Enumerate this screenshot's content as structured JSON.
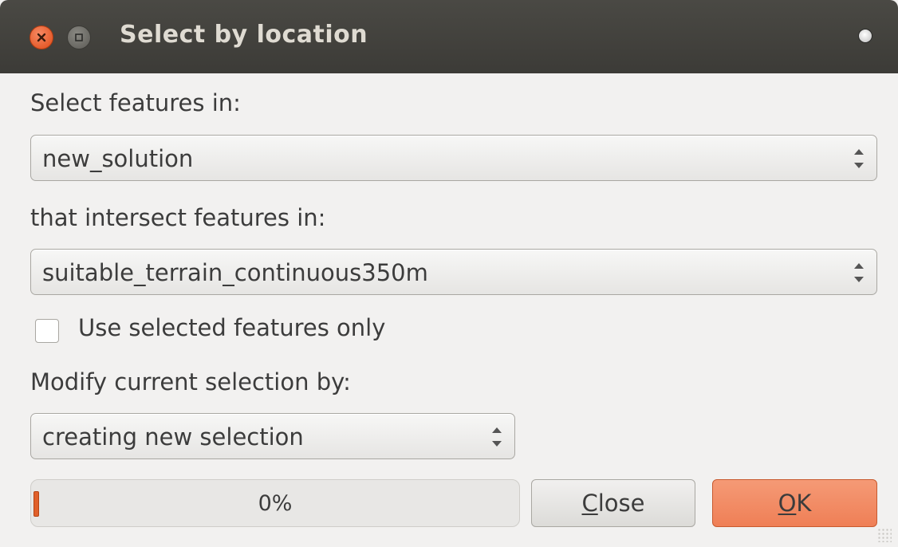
{
  "window": {
    "title": "Select by location"
  },
  "form": {
    "select_features_label": "Select features in:",
    "select_features_value": "new_solution",
    "intersect_label": "that intersect features in:",
    "intersect_value": "suitable_terrain_continuous350m",
    "use_selected_label": "Use selected features only",
    "use_selected_checked": false,
    "modify_label": "Modify current selection by:",
    "modify_value": "creating new selection"
  },
  "progress": {
    "text": "0%",
    "value": 0
  },
  "buttons": {
    "close_mnemonic": "C",
    "close_rest": "lose",
    "ok_mnemonic": "O",
    "ok_rest": "K"
  },
  "colors": {
    "accent": "#ef7f56",
    "titlebar": "#3c3b37",
    "progress_fill": "#e0602a"
  }
}
